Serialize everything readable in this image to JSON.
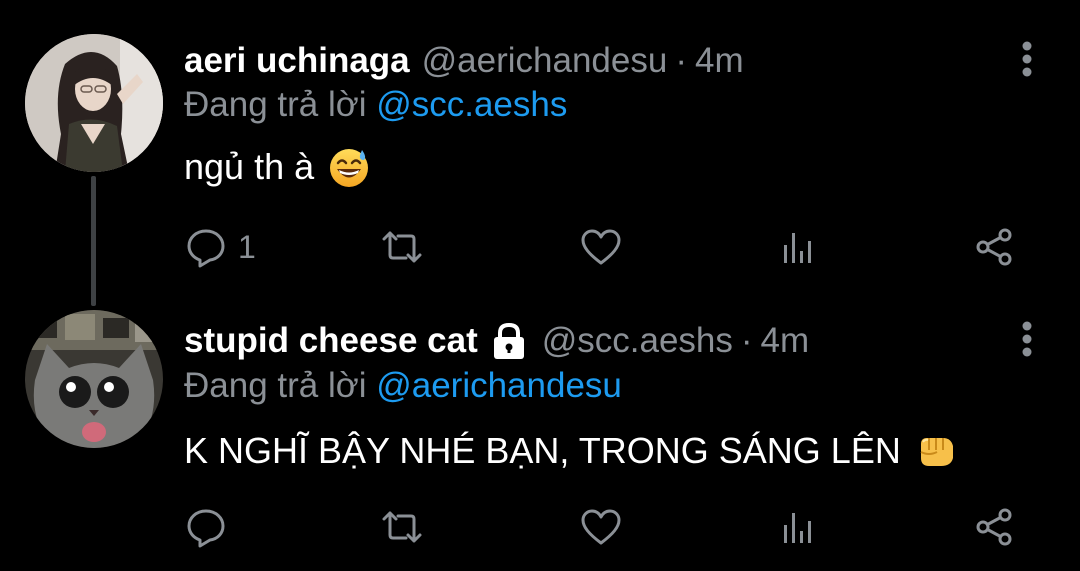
{
  "tweets": [
    {
      "display_name": "aeri uchinaga",
      "handle": "@aerichandesu",
      "separator": "·",
      "time": "4m",
      "locked": false,
      "replying_prefix": "Đang trả lời",
      "replying_to": "@scc.aeshs",
      "text": "ngủ th à",
      "emoji": "grinning-face-with-sweat",
      "reply_count": "1",
      "retweet_count": "",
      "like_count": ""
    },
    {
      "display_name": "stupid cheese cat",
      "handle": "@scc.aeshs",
      "separator": "·",
      "time": "4m",
      "locked": true,
      "replying_prefix": "Đang trả lời",
      "replying_to": "@aerichandesu",
      "text": "K NGHĨ BẬY NHÉ BẠN, TRONG SÁNG LÊN",
      "emoji": "oncoming-fist",
      "reply_count": "",
      "retweet_count": "",
      "like_count": ""
    }
  ],
  "colors": {
    "background": "#000000",
    "primary_text": "#ffffff",
    "secondary_text": "#8b9096",
    "mention": "#1d9bf0",
    "thread_line": "#3e4144"
  },
  "icons": [
    "reply-icon",
    "retweet-icon",
    "like-icon",
    "analytics-icon",
    "share-icon",
    "more-options-icon",
    "lock-icon"
  ]
}
